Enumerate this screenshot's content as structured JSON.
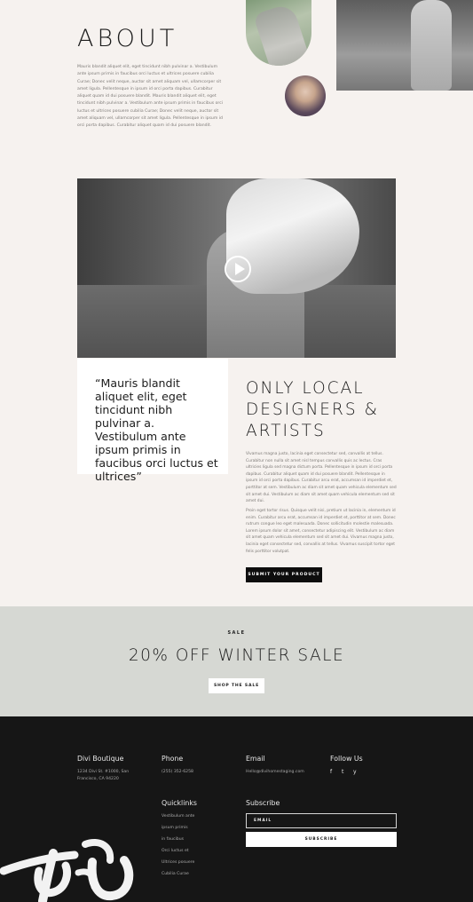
{
  "about": {
    "title": "ABOUT",
    "body": "Mauris blandit aliquet elit, eget tincidunt nibh pulvinar a. Vestibulum ante ipsum primis in faucibus orci luctus et ultrices posuere cubilia Curae; Donec velit neque, auctor sit amet aliquam vel, ullamcorper sit amet ligula. Pellentesque in ipsum id orci porta dapibus. Curabitur aliquet quam id dui posuere blandit. Mauris blandit aliquet elit, eget tincidunt nibh pulvinar a. Vestibulum ante ipsum primis in faucibus orci luctus et ultrices posuere cubilia Curae; Donec velit neque, auctor sit amet aliquam vel, ullamcorper sit amet ligula. Pellentesque in ipsum id orci porta dapibus. Curabitur aliquet quam id dui posuere blandit."
  },
  "quote": {
    "text": "“Mauris blandit aliquet elit, eget tincidunt nibh pulvinar a. Vestibulum ante ipsum primis in faucibus orci luctus et ultrices”"
  },
  "local": {
    "title": "ONLY LOCAL DESIGNERS & ARTISTS",
    "p1": "Vivamus magna justo, lacinia eget consectetur sed, convallis at tellus. Curabitur non nulla sit amet nisl tempus convallis quis ac lectus. Cras ultricies ligula sed magna dictum porta. Pellentesque in ipsum id orci porta dapibus. Curabitur aliquet quam id dui posuere blandit. Pellentesque in ipsum id orci porta dapibus. Curabitur arcu erat, accumsan id imperdiet et, porttitor at sem. Vestibulum ac diam sit amet quam vehicula elementum sed sit amet dui. Vestibulum ac diam sit amet quam vehicula elementum sed sit amet dui.",
    "p2": "Proin eget tortor risus. Quisque velit nisi, pretium ut lacinia in, elementum id enim. Curabitur arcu erat, accumsan id imperdiet et, porttitor at sem. Donec rutrum congue leo eget malesuada. Donec sollicitudin molestie malesuada. Lorem ipsum dolor sit amet, consectetur adipiscing elit. Vestibulum ac diam sit amet quam vehicula elementum sed sit amet dui. Vivamus magna justo, lacinia eget consectetur sed, convallis at tellus. Vivamus suscipit tortor eget felis porttitor volutpat.",
    "button": "SUBMIT YOUR PRODUCT"
  },
  "sale": {
    "kicker": "SALE",
    "title": "20% OFF WINTER SALE",
    "button": "SHOP THE SALE"
  },
  "footer": {
    "brand": "Divi Boutique",
    "address": "1234 Divi St. #1000, San Francisco, CA 94220",
    "phone_heading": "Phone",
    "phone": "(255) 352-6258",
    "email_heading": "Email",
    "email": "Hello@divihomestaging.com",
    "follow_heading": "Follow Us",
    "social": [
      "f",
      "t",
      "y"
    ],
    "quicklinks_heading": "Quicklinks",
    "quicklinks": [
      "Vestibulum ante",
      "ipsum primis",
      "in faucibus",
      "Orci luctus et",
      "Ultrices posuere",
      "Cubilia Curae"
    ],
    "subscribe_heading": "Subscribe",
    "email_placeholder": "EMAIL",
    "subscribe_button": "SUBSCRIBE"
  },
  "colors": {
    "page_bg": "#f6f2ef",
    "sale_bg": "#d6d8d3",
    "footer_bg": "#161616",
    "button_dark": "#0d0d0d"
  }
}
